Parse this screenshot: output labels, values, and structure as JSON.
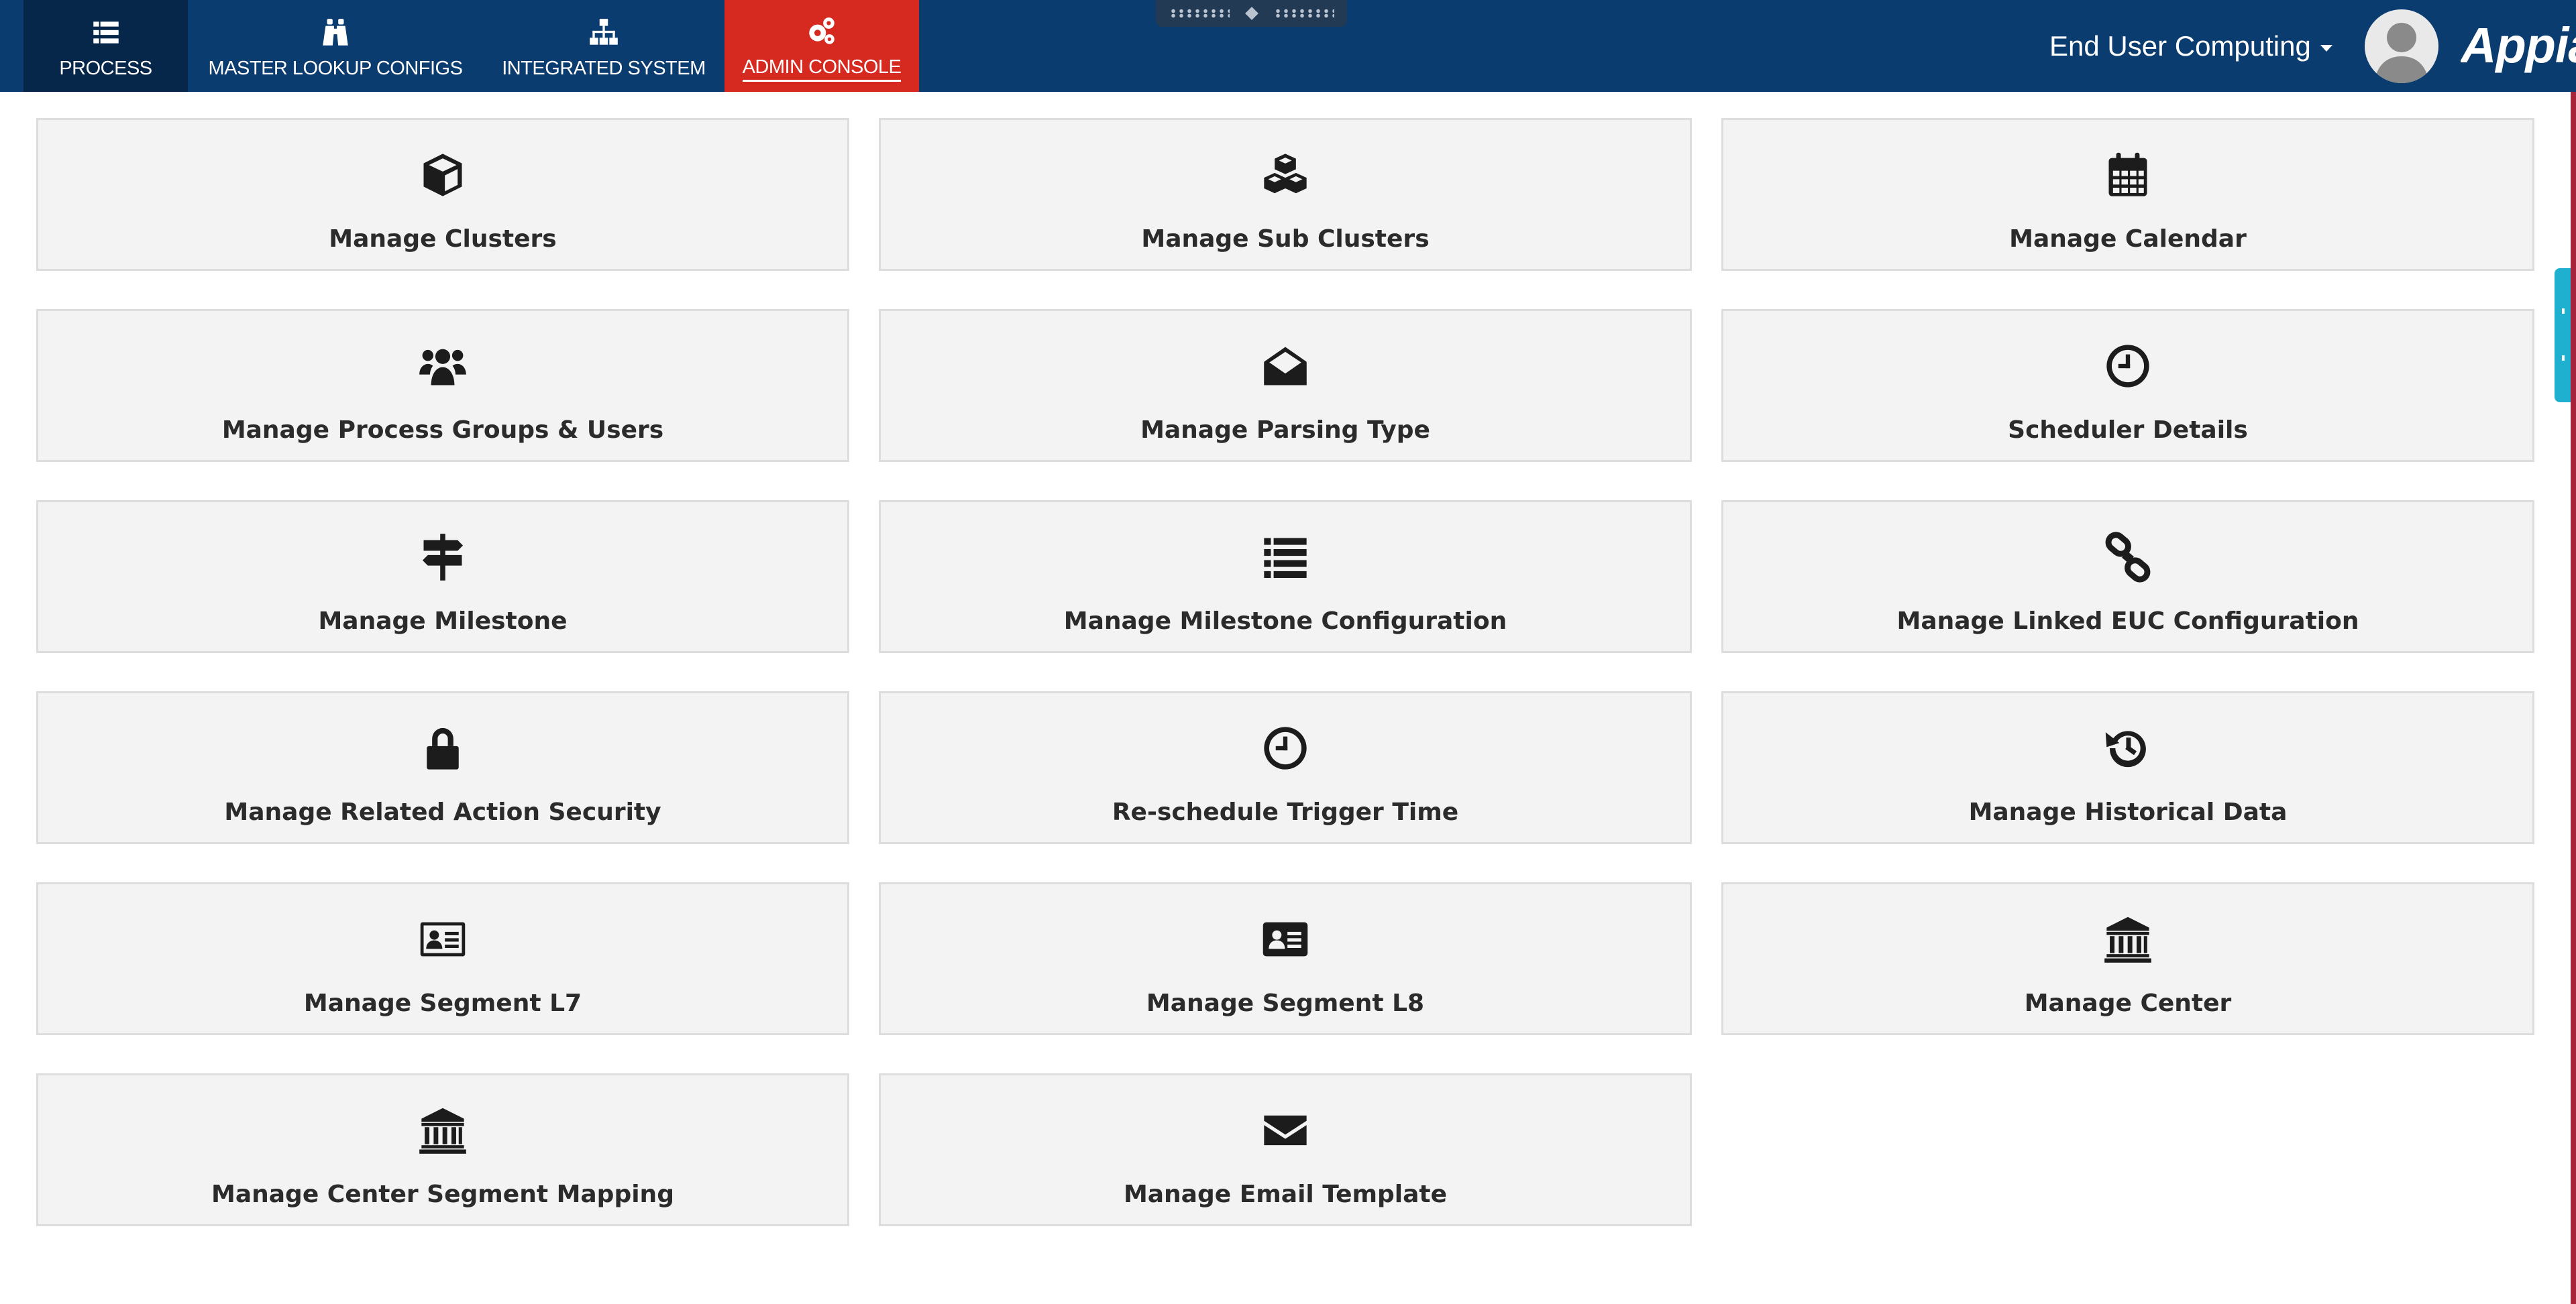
{
  "nav": {
    "items": [
      {
        "label": "PROCESS",
        "icon": "list-icon"
      },
      {
        "label": "MASTER LOOKUP CONFIGS",
        "icon": "binoculars-icon"
      },
      {
        "label": "INTEGRATED SYSTEM",
        "icon": "sitemap-icon"
      },
      {
        "label": "ADMIN CONSOLE",
        "icon": "cogs-icon",
        "active": true
      }
    ]
  },
  "user": {
    "menu_label": "End User Computing"
  },
  "brand": {
    "name": "Appian"
  },
  "tiles": [
    {
      "label": "Manage Clusters",
      "icon": "cube-icon"
    },
    {
      "label": "Manage Sub Clusters",
      "icon": "cubes-icon"
    },
    {
      "label": "Manage Calendar",
      "icon": "calendar-icon"
    },
    {
      "label": "Manage Process Groups & Users",
      "icon": "users-icon"
    },
    {
      "label": "Manage Parsing Type",
      "icon": "envelope-open-icon"
    },
    {
      "label": "Scheduler Details",
      "icon": "clock-icon"
    },
    {
      "label": "Manage Milestone",
      "icon": "signpost-icon"
    },
    {
      "label": "Manage Milestone Configuration",
      "icon": "list-icon"
    },
    {
      "label": "Manage Linked EUC Configuration",
      "icon": "chain-icon"
    },
    {
      "label": "Manage Related Action Security",
      "icon": "lock-icon"
    },
    {
      "label": "Re-schedule Trigger Time",
      "icon": "clock-icon"
    },
    {
      "label": "Manage Historical Data",
      "icon": "history-icon"
    },
    {
      "label": "Manage Segment L7",
      "icon": "id-card-outline-icon"
    },
    {
      "label": "Manage Segment L8",
      "icon": "id-card-icon"
    },
    {
      "label": "Manage Center",
      "icon": "institution-icon"
    },
    {
      "label": "Manage Center Segment Mapping",
      "icon": "institution-icon"
    },
    {
      "label": "Manage Email Template",
      "icon": "envelope-icon"
    }
  ],
  "colors": {
    "header_bg": "#0a3c6f",
    "active_tab": "#d6291f",
    "process_tab": "#06264a",
    "tile_bg": "#f2f3f2",
    "side_tab": "#1fb0cf"
  }
}
